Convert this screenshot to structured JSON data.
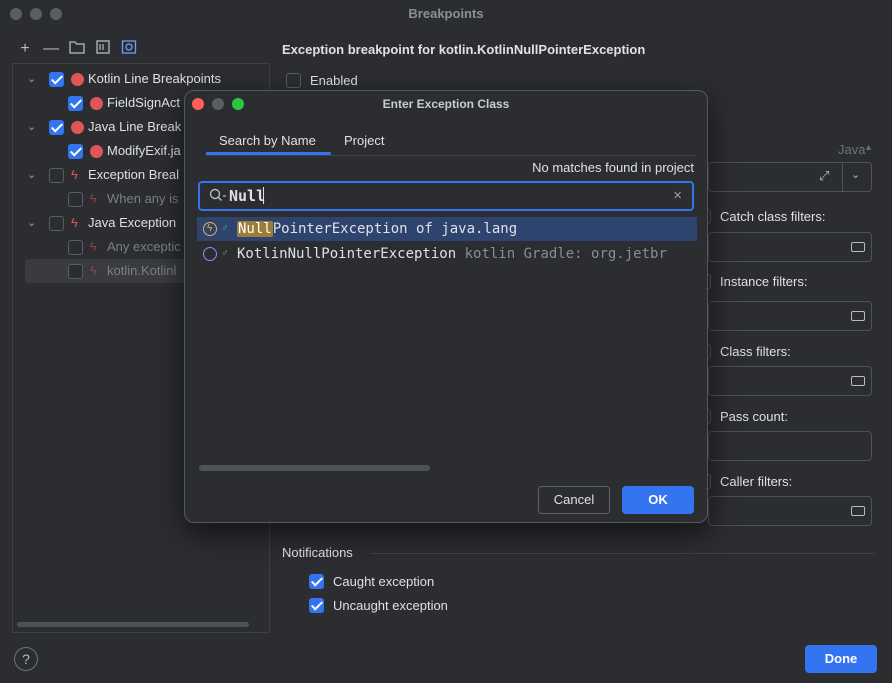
{
  "window": {
    "title": "Breakpoints"
  },
  "toolbar": {
    "add": "+",
    "remove": "—"
  },
  "tree": {
    "items": [
      {
        "label": "Kotlin Line Breakpoints",
        "checked": true,
        "expanded": true
      },
      {
        "label": "FieldSignAct",
        "checked": true
      },
      {
        "label": "Java Line Break",
        "checked": true,
        "expanded": true
      },
      {
        "label": "ModifyExif.ja",
        "checked": true
      },
      {
        "label": "Exception Breal",
        "checked": false,
        "expanded": true
      },
      {
        "label": "When any is",
        "checked": false
      },
      {
        "label": "Java Exception",
        "checked": false,
        "expanded": true
      },
      {
        "label": "Any exceptic",
        "checked": false
      },
      {
        "label": "kotlin.Kotlinl",
        "checked": false,
        "selected": true
      }
    ]
  },
  "right": {
    "title": "Exception breakpoint for kotlin.KotlinNullPointerException",
    "enabled_label": "Enabled",
    "lang_label": "Java",
    "catch_filters": "Catch class filters:",
    "instance_filters": "Instance filters:",
    "class_filters": "Class filters:",
    "pass_count": "Pass count:",
    "caller_filters": "Caller filters:",
    "notifications": "Notifications",
    "caught": "Caught exception",
    "uncaught": "Uncaught exception"
  },
  "footer": {
    "help": "?",
    "done": "Done"
  },
  "dialog": {
    "title": "Enter Exception Class",
    "tabs": [
      "Search by Name",
      "Project"
    ],
    "no_matches": "No matches found in project",
    "search_value": "Null",
    "results": [
      {
        "highlight": "Null",
        "rest": "PointerException of java.lang",
        "extra": ""
      },
      {
        "highlight": "",
        "rest": "KotlinNullPointerException",
        "extra": " kotlin Gradle: org.jetbr"
      }
    ],
    "cancel": "Cancel",
    "ok": "OK"
  },
  "colors": {
    "accent": "#3574f0",
    "breakpoint": "#e05555",
    "selection": "#2e436e"
  }
}
